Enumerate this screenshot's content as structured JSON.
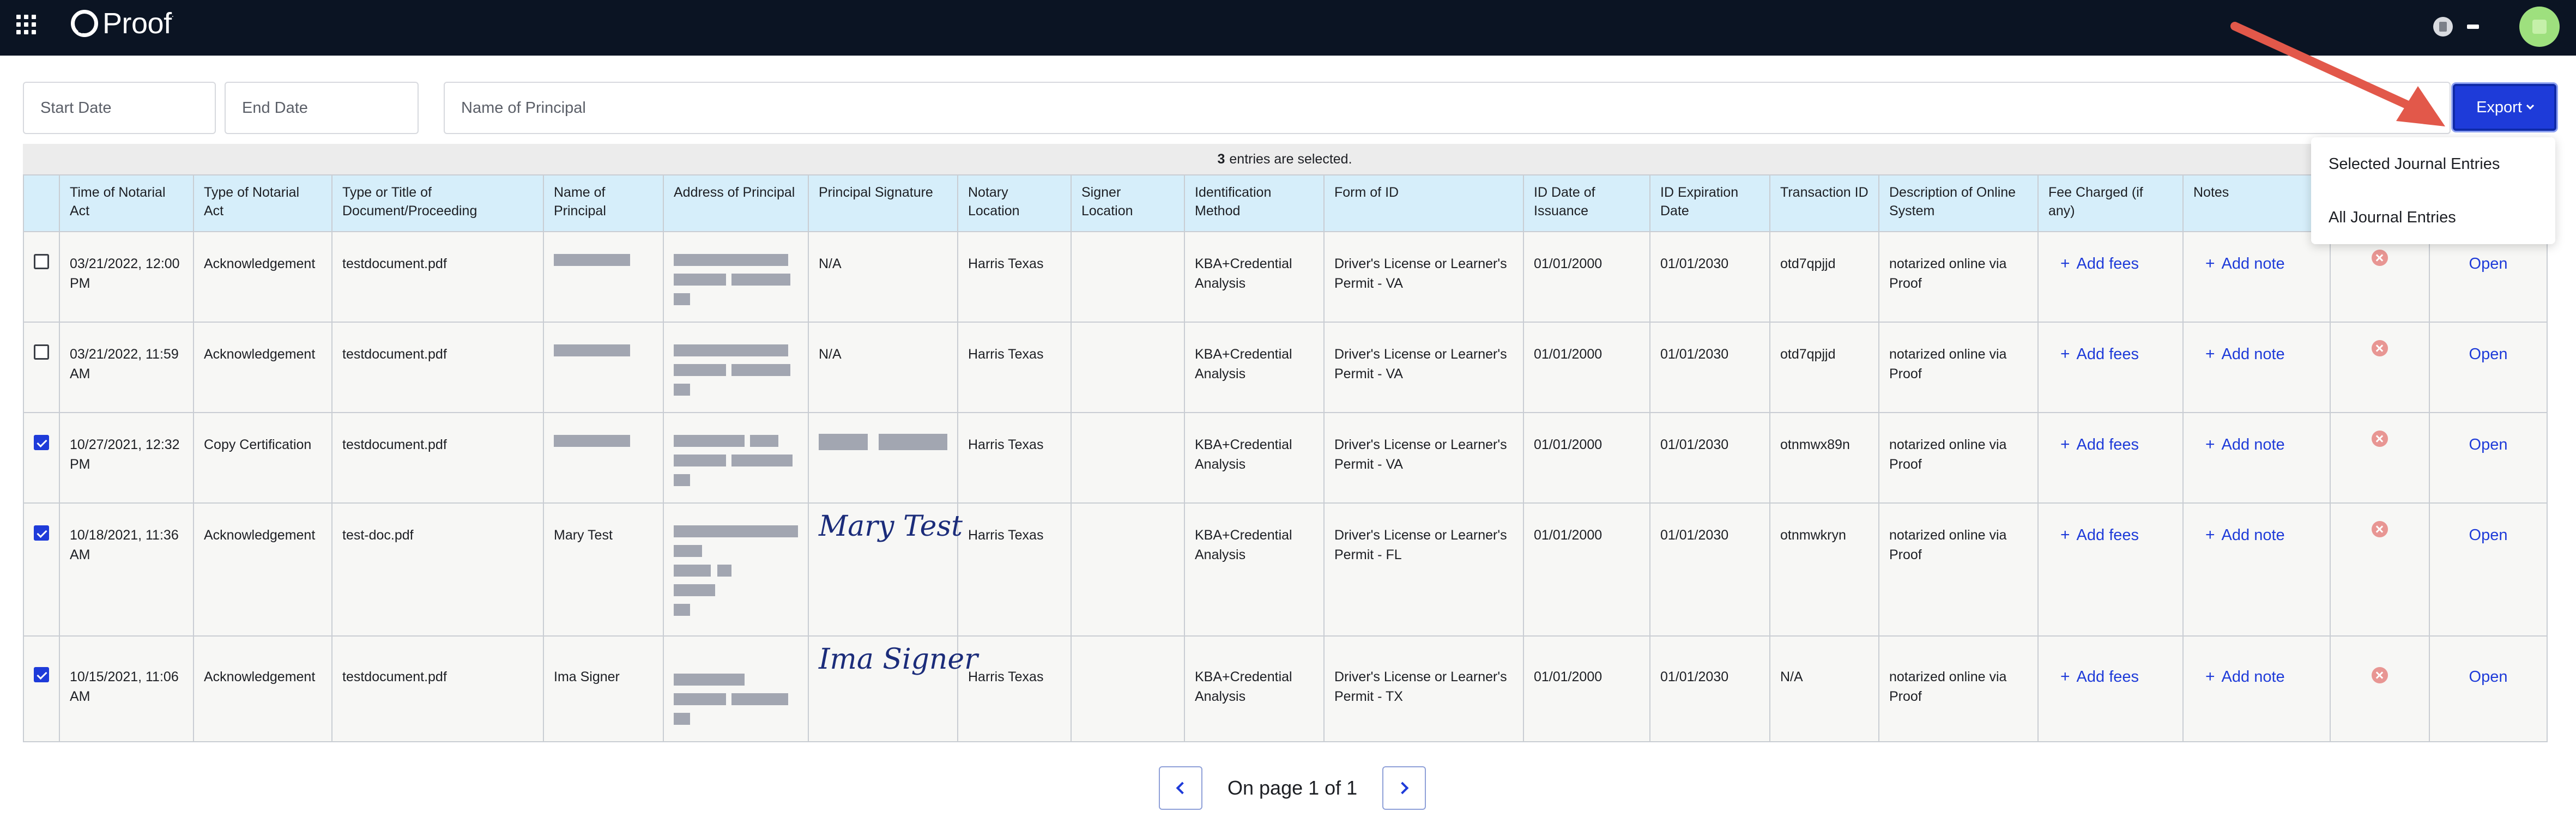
{
  "app": {
    "logo_text": "Proof",
    "logo_mark": "."
  },
  "filters": {
    "start_date_placeholder": "Start Date",
    "end_date_placeholder": "End Date",
    "principal_placeholder": "Name of Principal",
    "export_label": "Export"
  },
  "export_menu": {
    "items": [
      "Selected Journal Entries",
      "All Journal Entries"
    ]
  },
  "selection": {
    "count": "3",
    "text": "entries are selected."
  },
  "table": {
    "headers": [
      "Time of Notarial Act",
      "Type of Notarial Act",
      "Type or Title of Document/Proceeding",
      "Name of Principal",
      "Address of Principal",
      "Principal Signature",
      "Notary Location",
      "Signer Location",
      "Identification Method",
      "Form of ID",
      "ID Date of Issuance",
      "ID Expiration Date",
      "Transaction ID",
      "Description of Online System",
      "Fee Charged (if any)",
      "Notes"
    ],
    "add_fees_label": "Add fees",
    "add_note_label": "Add note",
    "open_label": "Open",
    "rows": [
      {
        "checked": false,
        "time": "03/21/2022, 12:00 PM",
        "type": "Acknowledgement",
        "document": "testdocument.pdf",
        "name": "",
        "signature": "N/A",
        "notary_location": "Harris Texas",
        "signer_location": "",
        "id_method": "KBA+Credential Analysis",
        "form_of_id": "Driver's License or Learner's Permit - VA",
        "issued": "01/01/2000",
        "expires": "01/01/2030",
        "transaction_id": "otd7qpjjd",
        "online_system": "notarized online via Proof"
      },
      {
        "checked": false,
        "time": "03/21/2022, 11:59 AM",
        "type": "Acknowledgement",
        "document": "testdocument.pdf",
        "name": "",
        "signature": "N/A",
        "notary_location": "Harris Texas",
        "signer_location": "",
        "id_method": "KBA+Credential Analysis",
        "form_of_id": "Driver's License or Learner's Permit - VA",
        "issued": "01/01/2000",
        "expires": "01/01/2030",
        "transaction_id": "otd7qpjjd",
        "online_system": "notarized online via Proof"
      },
      {
        "checked": true,
        "time": "10/27/2021, 12:32 PM",
        "type": "Copy Certification",
        "document": "testdocument.pdf",
        "name": "",
        "signature": "",
        "notary_location": "Harris Texas",
        "signer_location": "",
        "id_method": "KBA+Credential Analysis",
        "form_of_id": "Driver's License or Learner's Permit - VA",
        "issued": "01/01/2000",
        "expires": "01/01/2030",
        "transaction_id": "otnmwx89n",
        "online_system": "notarized online via Proof"
      },
      {
        "checked": true,
        "time": "10/18/2021, 11:36 AM",
        "type": "Acknowledgement",
        "document": "test-doc.pdf",
        "name": "Mary Test",
        "signature": "Mary Test",
        "notary_location": "Harris Texas",
        "signer_location": "",
        "id_method": "KBA+Credential Analysis",
        "form_of_id": "Driver's License or Learner's Permit - FL",
        "issued": "01/01/2000",
        "expires": "01/01/2030",
        "transaction_id": "otnmwkryn",
        "online_system": "notarized online via Proof"
      },
      {
        "checked": true,
        "time": "10/15/2021, 11:06 AM",
        "type": "Acknowledgement",
        "document": "testdocument.pdf",
        "name": "Ima Signer",
        "signature": "Ima Signer",
        "notary_location": "Harris Texas",
        "signer_location": "",
        "id_method": "KBA+Credential Analysis",
        "form_of_id": "Driver's License or Learner's Permit - TX",
        "issued": "01/01/2000",
        "expires": "01/01/2030",
        "transaction_id": "N/A",
        "online_system": "notarized online via Proof"
      }
    ]
  },
  "pagination": {
    "text": "On page 1 of 1"
  }
}
